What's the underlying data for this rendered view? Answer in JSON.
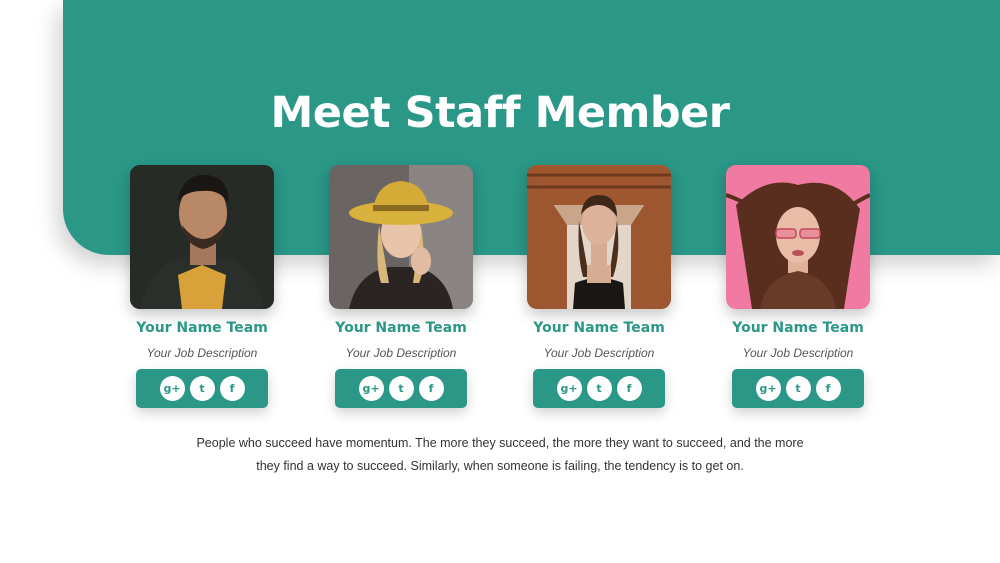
{
  "title": "Meet Staff Member",
  "accent_color": "#2a9787",
  "members": [
    {
      "name": "Your Name Team",
      "job": "Your Job Description"
    },
    {
      "name": "Your Name Team",
      "job": "Your Job Description"
    },
    {
      "name": "Your Name Team",
      "job": "Your Job Description"
    },
    {
      "name": "Your Name Team",
      "job": "Your Job Description"
    }
  ],
  "social": {
    "google": "g+",
    "twitter": "t",
    "facebook": "f"
  },
  "social_icons": [
    "google-plus-icon",
    "twitter-icon",
    "facebook-icon"
  ],
  "description": "People who succeed have momentum. The more they succeed, the more they want to succeed, and the more they find a way to succeed. Similarly, when someone is failing, the tendency is to get on."
}
